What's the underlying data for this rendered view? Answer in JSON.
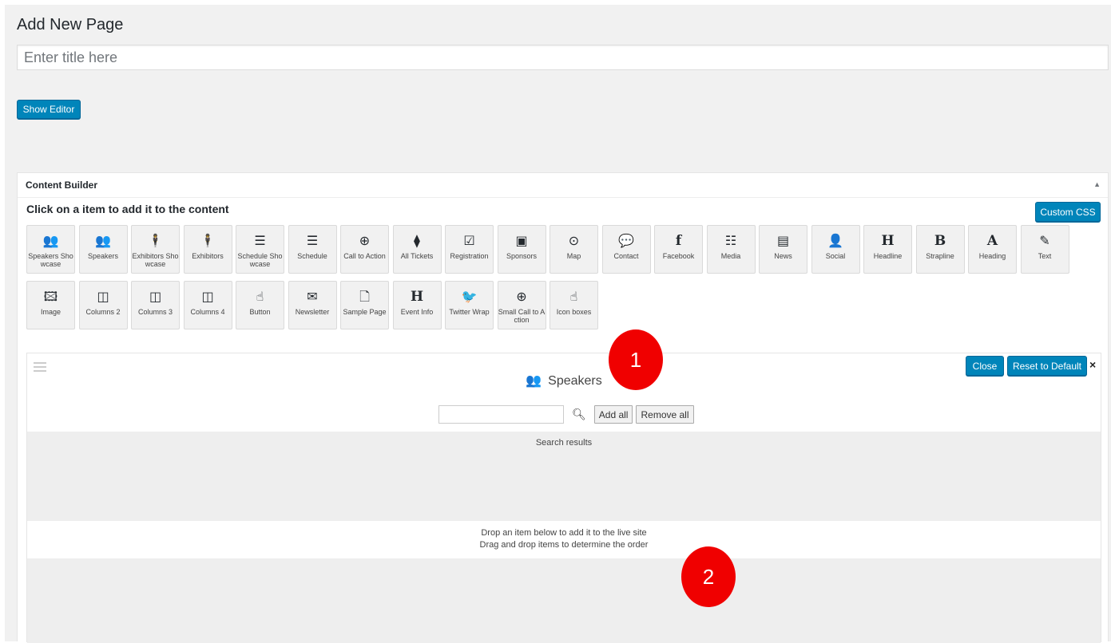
{
  "page": {
    "heading": "Add New Page",
    "title_placeholder": "Enter title here",
    "show_editor_label": "Show Editor"
  },
  "builder": {
    "title": "Content Builder",
    "collapse_icon": "triangle-up-icon",
    "intro": "Click on a item to add it to the content",
    "custom_css_label": "Custom CSS",
    "tiles": [
      {
        "label": "Speakers Showcase",
        "icon": "users-icon"
      },
      {
        "label": "Speakers",
        "icon": "users-icon"
      },
      {
        "label": "Exhibitors Showcase",
        "icon": "person-icon"
      },
      {
        "label": "Exhibitors",
        "icon": "person-icon"
      },
      {
        "label": "Schedule Showcase",
        "icon": "server-icon"
      },
      {
        "label": "Schedule",
        "icon": "server-icon"
      },
      {
        "label": "Call to Action",
        "icon": "gamepad-icon"
      },
      {
        "label": "All Tickets",
        "icon": "ticket-icon"
      },
      {
        "label": "Registration",
        "icon": "checkbox-icon"
      },
      {
        "label": "Sponsors",
        "icon": "money-icon"
      },
      {
        "label": "Map",
        "icon": "dot-circle-icon"
      },
      {
        "label": "Contact",
        "icon": "comment-icon"
      },
      {
        "label": "Facebook",
        "icon": "facebook-icon"
      },
      {
        "label": "Media",
        "icon": "list-icon"
      },
      {
        "label": "News",
        "icon": "newspaper-icon"
      },
      {
        "label": "Social",
        "icon": "user-plus-icon"
      },
      {
        "label": "Headline",
        "icon": "heading-h-icon"
      },
      {
        "label": "Strapline",
        "icon": "bold-b-icon"
      },
      {
        "label": "Heading",
        "icon": "letter-a-icon"
      },
      {
        "label": "Text",
        "icon": "pencil-icon"
      },
      {
        "label": "Image",
        "icon": "image-icon"
      },
      {
        "label": "Columns 2",
        "icon": "columns-icon"
      },
      {
        "label": "Columns 3",
        "icon": "columns-icon"
      },
      {
        "label": "Columns 4",
        "icon": "columns-icon"
      },
      {
        "label": "Button",
        "icon": "pointer-hand-icon"
      },
      {
        "label": "Newsletter",
        "icon": "envelope-icon"
      },
      {
        "label": "Sample Page",
        "icon": "file-icon"
      },
      {
        "label": "Event Info",
        "icon": "heading-h-icon"
      },
      {
        "label": "Twitter Wrap",
        "icon": "twitter-icon"
      },
      {
        "label": "Small Call to Action",
        "icon": "gamepad-icon"
      },
      {
        "label": "Icon boxes",
        "icon": "pointer-hand-icon"
      }
    ]
  },
  "panel": {
    "title": "Speakers",
    "title_icon": "users-icon",
    "close_label": "Close",
    "reset_label": "Reset to Default",
    "close_x": "×",
    "search_value": "",
    "add_all_label": "Add all",
    "remove_all_label": "Remove all",
    "results_label": "Search results",
    "drop_line1": "Drop an item below to add it to the live site",
    "drop_line2": "Drag and drop items to determine the order"
  },
  "markers": [
    "1",
    "2"
  ],
  "colors": {
    "primary_button": "#0085ba",
    "background": "#f1f1f1",
    "marker": "#f00000"
  }
}
